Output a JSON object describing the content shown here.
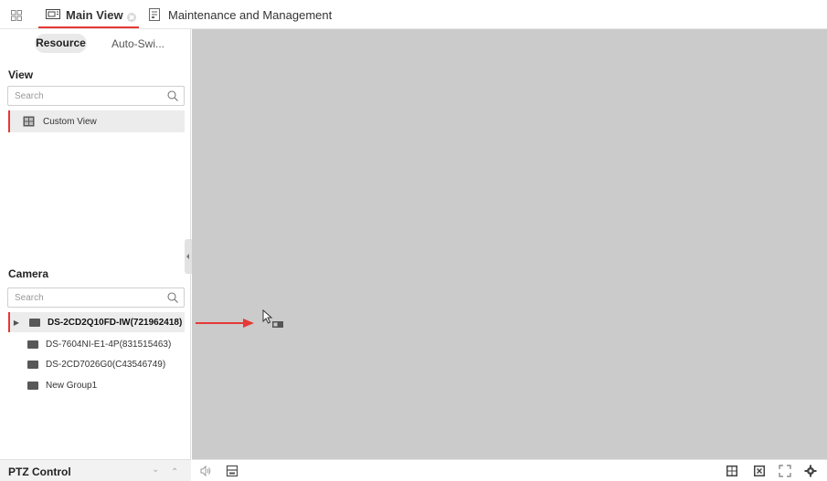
{
  "tabs": {
    "main_view": "Main View",
    "maintenance": "Maintenance and Management"
  },
  "left_panel": {
    "resource_tab": "Resource",
    "auto_switch_tab": "Auto-Swi...",
    "view": {
      "title": "View",
      "search_placeholder": "Search",
      "items": [
        "Custom View"
      ]
    },
    "camera": {
      "title": "Camera",
      "search_placeholder": "Search",
      "items": [
        "DS-2CD2Q10FD-IW(721962418)",
        "DS-7604NI-E1-4P(831515463)",
        "DS-2CD7026G0(C43546749)",
        "New Group1"
      ]
    },
    "ptz_control": "PTZ Control"
  },
  "icons": {
    "grid": "grid-icon",
    "monitor": "monitor-icon",
    "maintenance": "maintenance-icon",
    "search": "search-icon",
    "folder": "folder-icon",
    "speaker": "speaker-icon",
    "save": "save-icon",
    "layout": "layout-icon",
    "close_all": "close-all-icon",
    "fullscreen": "fullscreen-icon",
    "settings": "gear-icon"
  },
  "colors": {
    "accent": "#e53935",
    "display_background": "#cbcbcb",
    "selected_row": "#ececec"
  }
}
